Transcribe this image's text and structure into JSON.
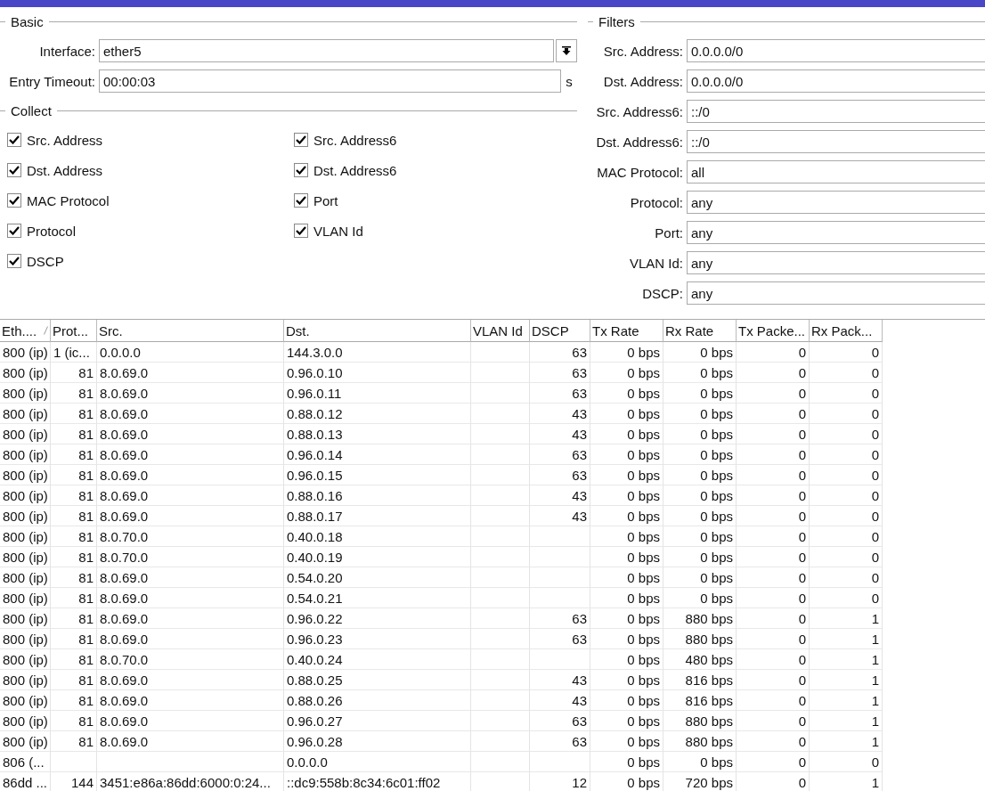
{
  "basic": {
    "legend": "Basic",
    "fields": [
      {
        "kind": "dropdown",
        "label": "Interface:",
        "value": "ether5"
      },
      {
        "kind": "text",
        "label": "Entry Timeout:",
        "value": "00:00:03",
        "unit": "s"
      }
    ]
  },
  "collect": {
    "legend": "Collect",
    "items": [
      {
        "label": "Src. Address",
        "checked": true
      },
      {
        "label": "Dst. Address",
        "checked": true
      },
      {
        "label": "MAC Protocol",
        "checked": true
      },
      {
        "label": "Protocol",
        "checked": true
      },
      {
        "label": "DSCP",
        "checked": true
      },
      {
        "label": "Src. Address6",
        "checked": true
      },
      {
        "label": "Dst. Address6",
        "checked": true
      },
      {
        "label": "Port",
        "checked": true
      },
      {
        "label": "VLAN Id",
        "checked": true
      }
    ]
  },
  "filters": {
    "legend": "Filters",
    "fields": [
      {
        "label": "Src. Address:",
        "value": "0.0.0.0/0"
      },
      {
        "label": "Dst. Address:",
        "value": "0.0.0.0/0"
      },
      {
        "label": "Src. Address6:",
        "value": "::/0"
      },
      {
        "label": "Dst. Address6:",
        "value": "::/0"
      },
      {
        "label": "MAC Protocol:",
        "value": "all"
      },
      {
        "label": "Protocol:",
        "value": "any"
      },
      {
        "label": "Port:",
        "value": "any"
      },
      {
        "label": "VLAN Id:",
        "value": "any"
      },
      {
        "label": "DSCP:",
        "value": "any"
      }
    ]
  },
  "table": {
    "columns": [
      {
        "label": "Eth....",
        "kind": "text",
        "sorted": true
      },
      {
        "label": "Prot...",
        "kind": "number",
        "sorted": false
      },
      {
        "label": "Src.",
        "kind": "text",
        "sorted": false
      },
      {
        "label": "Dst.",
        "kind": "text",
        "sorted": false
      },
      {
        "label": "VLAN Id",
        "kind": "number",
        "sorted": false
      },
      {
        "label": "DSCP",
        "kind": "number",
        "sorted": false
      },
      {
        "label": "Tx Rate",
        "kind": "number",
        "sorted": false
      },
      {
        "label": "Rx Rate",
        "kind": "number",
        "sorted": false
      },
      {
        "label": "Tx Packe...",
        "kind": "number",
        "sorted": false
      },
      {
        "label": "Rx Pack...",
        "kind": "number",
        "sorted": false
      }
    ],
    "rows": [
      [
        "800 (ip)",
        "1 (ic...",
        "0.0.0.0",
        "144.3.0.0",
        null,
        "63",
        "0 bps",
        "0 bps",
        "0",
        "0"
      ],
      [
        "800 (ip)",
        "81",
        "8.0.69.0",
        "0.96.0.10",
        null,
        "63",
        "0 bps",
        "0 bps",
        "0",
        "0"
      ],
      [
        "800 (ip)",
        "81",
        "8.0.69.0",
        "0.96.0.11",
        null,
        "63",
        "0 bps",
        "0 bps",
        "0",
        "0"
      ],
      [
        "800 (ip)",
        "81",
        "8.0.69.0",
        "0.88.0.12",
        null,
        "43",
        "0 bps",
        "0 bps",
        "0",
        "0"
      ],
      [
        "800 (ip)",
        "81",
        "8.0.69.0",
        "0.88.0.13",
        null,
        "43",
        "0 bps",
        "0 bps",
        "0",
        "0"
      ],
      [
        "800 (ip)",
        "81",
        "8.0.69.0",
        "0.96.0.14",
        null,
        "63",
        "0 bps",
        "0 bps",
        "0",
        "0"
      ],
      [
        "800 (ip)",
        "81",
        "8.0.69.0",
        "0.96.0.15",
        null,
        "63",
        "0 bps",
        "0 bps",
        "0",
        "0"
      ],
      [
        "800 (ip)",
        "81",
        "8.0.69.0",
        "0.88.0.16",
        null,
        "43",
        "0 bps",
        "0 bps",
        "0",
        "0"
      ],
      [
        "800 (ip)",
        "81",
        "8.0.69.0",
        "0.88.0.17",
        null,
        "43",
        "0 bps",
        "0 bps",
        "0",
        "0"
      ],
      [
        "800 (ip)",
        "81",
        "8.0.70.0",
        "0.40.0.18",
        null,
        null,
        "0 bps",
        "0 bps",
        "0",
        "0"
      ],
      [
        "800 (ip)",
        "81",
        "8.0.70.0",
        "0.40.0.19",
        null,
        null,
        "0 bps",
        "0 bps",
        "0",
        "0"
      ],
      [
        "800 (ip)",
        "81",
        "8.0.69.0",
        "0.54.0.20",
        null,
        null,
        "0 bps",
        "0 bps",
        "0",
        "0"
      ],
      [
        "800 (ip)",
        "81",
        "8.0.69.0",
        "0.54.0.21",
        null,
        null,
        "0 bps",
        "0 bps",
        "0",
        "0"
      ],
      [
        "800 (ip)",
        "81",
        "8.0.69.0",
        "0.96.0.22",
        null,
        "63",
        "0 bps",
        "880 bps",
        "0",
        "1"
      ],
      [
        "800 (ip)",
        "81",
        "8.0.69.0",
        "0.96.0.23",
        null,
        "63",
        "0 bps",
        "880 bps",
        "0",
        "1"
      ],
      [
        "800 (ip)",
        "81",
        "8.0.70.0",
        "0.40.0.24",
        null,
        null,
        "0 bps",
        "480 bps",
        "0",
        "1"
      ],
      [
        "800 (ip)",
        "81",
        "8.0.69.0",
        "0.88.0.25",
        null,
        "43",
        "0 bps",
        "816 bps",
        "0",
        "1"
      ],
      [
        "800 (ip)",
        "81",
        "8.0.69.0",
        "0.88.0.26",
        null,
        "43",
        "0 bps",
        "816 bps",
        "0",
        "1"
      ],
      [
        "800 (ip)",
        "81",
        "8.0.69.0",
        "0.96.0.27",
        null,
        "63",
        "0 bps",
        "880 bps",
        "0",
        "1"
      ],
      [
        "800 (ip)",
        "81",
        "8.0.69.0",
        "0.96.0.28",
        null,
        "63",
        "0 bps",
        "880 bps",
        "0",
        "1"
      ],
      [
        "806 (...",
        null,
        null,
        "0.0.0.0",
        null,
        null,
        "0 bps",
        "0 bps",
        "0",
        "0"
      ],
      [
        "86dd ...",
        "144",
        "3451:e86a:86dd:6000:0:24...",
        "::dc9:558b:8c34:6c01:ff02",
        null,
        "12",
        "0 bps",
        "720 bps",
        "0",
        "1"
      ]
    ]
  }
}
